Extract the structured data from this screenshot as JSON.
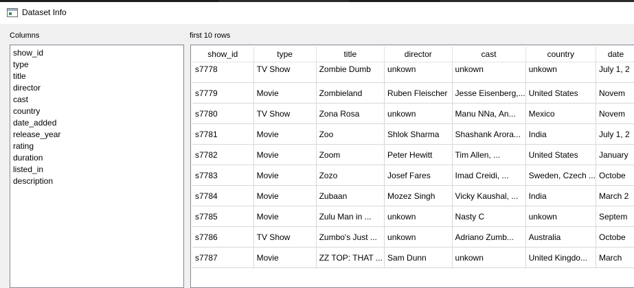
{
  "window": {
    "title": "Dataset Info"
  },
  "columns_panel": {
    "label": "Columns",
    "items": [
      "show_id",
      "type",
      "title",
      "director",
      "cast",
      "country",
      "date_added",
      "release_year",
      "rating",
      "duration",
      "listed_in",
      "description"
    ]
  },
  "rows_panel": {
    "label": "first 10 rows",
    "headers": [
      "show_id",
      "type",
      "title",
      "director",
      "cast",
      "country",
      "date"
    ],
    "rows": [
      [
        "s7778",
        "TV Show",
        "Zombie Dumb",
        "unkown",
        "unkown",
        "unkown",
        "July 1, 2"
      ],
      [
        "s7779",
        "Movie",
        "Zombieland",
        "Ruben Fleischer",
        "Jesse Eisenberg,...",
        "United States",
        "Novem"
      ],
      [
        "s7780",
        "TV Show",
        "Zona Rosa",
        "unkown",
        "Manu NNa, An...",
        "Mexico",
        "Novem"
      ],
      [
        "s7781",
        "Movie",
        "Zoo",
        "Shlok Sharma",
        "Shashank Arora...",
        "India",
        "July 1, 2"
      ],
      [
        "s7782",
        "Movie",
        "Zoom",
        "Peter Hewitt",
        "Tim Allen, ...",
        "United States",
        "January"
      ],
      [
        "s7783",
        "Movie",
        "Zozo",
        "Josef Fares",
        "Imad Creidi, ...",
        "Sweden, Czech ...",
        "Octobe"
      ],
      [
        "s7784",
        "Movie",
        "Zubaan",
        "Mozez Singh",
        "Vicky Kaushal, ...",
        "India",
        "March 2"
      ],
      [
        "s7785",
        "Movie",
        "Zulu Man in ...",
        "unkown",
        "Nasty C",
        "unkown",
        "Septem"
      ],
      [
        "s7786",
        "TV Show",
        "Zumbo's Just ...",
        "unkown",
        "Adriano Zumb...",
        "Australia",
        "Octobe"
      ],
      [
        "s7787",
        "Movie",
        "ZZ TOP: THAT ...",
        "Sam Dunn",
        "unkown",
        "United Kingdo...",
        "March"
      ]
    ]
  }
}
